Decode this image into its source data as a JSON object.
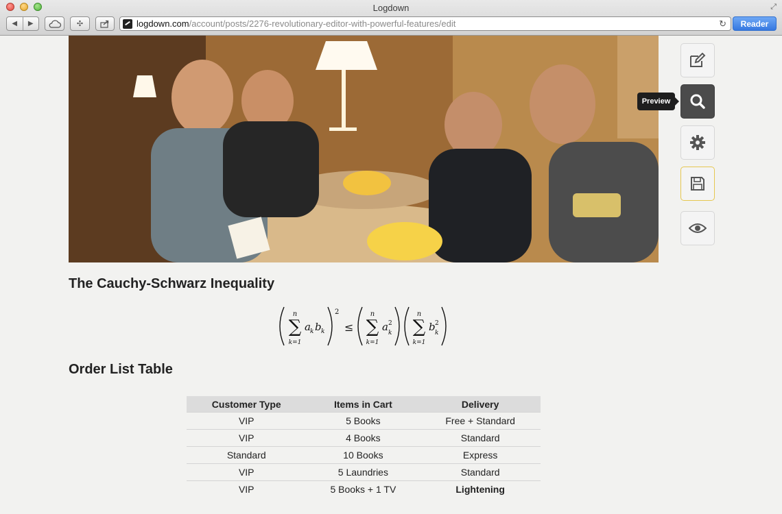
{
  "window": {
    "title": "Logdown"
  },
  "addressbar": {
    "host": "logdown.com",
    "path": "/account/posts/2276-revolutionary-editor-with-powerful-features/edit",
    "reader_label": "Reader"
  },
  "post": {
    "heading_1": "The Cauchy-Schwarz Inequality",
    "formula": {
      "sigma": "∑",
      "upper": "n",
      "lower": "k=1",
      "lhs_a": "a",
      "lhs_b": "b",
      "sub_k": "k",
      "exp_2": "2",
      "leq": "≤"
    },
    "heading_2": "Order List Table",
    "table": {
      "headers": [
        "Customer Type",
        "Items in Cart",
        "Delivery"
      ],
      "rows": [
        [
          "VIP",
          "5 Books",
          "Free + Standard"
        ],
        [
          "VIP",
          "4 Books",
          "Standard"
        ],
        [
          "Standard",
          "10 Books",
          "Express"
        ],
        [
          "VIP",
          "5 Laundries",
          "Standard"
        ],
        [
          "VIP",
          "5 Books + 1 TV",
          "Lightening"
        ]
      ]
    }
  },
  "toolbar": {
    "tooltip": "Preview",
    "tools": [
      {
        "icon": "edit-icon"
      },
      {
        "icon": "search-icon",
        "active": true
      },
      {
        "icon": "gear-icon"
      },
      {
        "icon": "save-icon"
      },
      {
        "icon": "eye-icon"
      }
    ]
  },
  "colors": {
    "reader_button": "#3577e0",
    "active_tool": "#4b4b4b",
    "save_border": "#e6c74f"
  }
}
